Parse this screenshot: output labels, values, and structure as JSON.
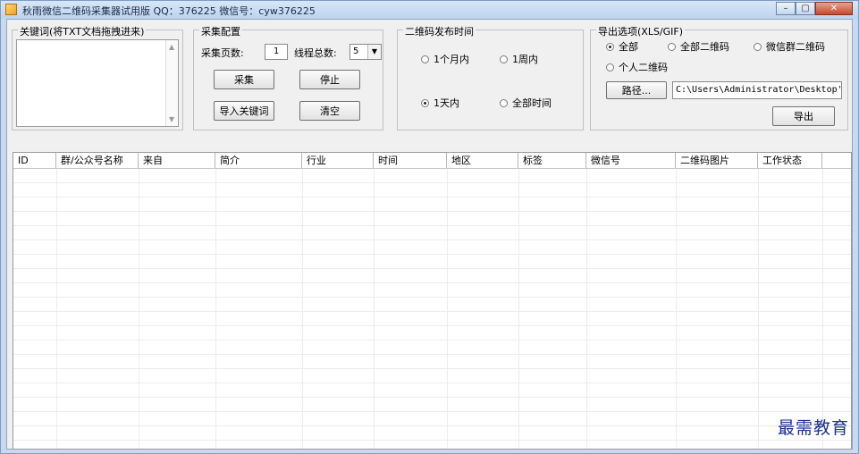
{
  "window": {
    "title": "秋雨微信二维码采集器试用版 QQ：376225   微信号：cyw376225",
    "min_glyph": "–",
    "max_glyph": "▢",
    "close_glyph": "✕"
  },
  "keywords": {
    "legend": "关键词(将TXT文档拖拽进来)",
    "value": ""
  },
  "collect_config": {
    "legend": "采集配置",
    "pages_label": "采集页数:",
    "pages_value": "1",
    "threads_label": "线程总数:",
    "threads_value": "5",
    "collect_button": "采集",
    "stop_button": "停止",
    "import_button": "导入关键词",
    "clear_button": "清空"
  },
  "publish_time": {
    "legend": "二维码发布时间",
    "options": [
      "1个月内",
      "1周内",
      "1天内",
      "全部时间"
    ],
    "selected": "1天内"
  },
  "export": {
    "legend": "导出选项(XLS/GIF)",
    "options": [
      "全部",
      "全部二维码",
      "微信群二维码",
      "个人二维码"
    ],
    "selected": "全部",
    "path_button": "路径...",
    "path_value": "C:\\Users\\Administrator\\Desktop'",
    "export_button": "导出"
  },
  "table": {
    "columns": [
      "ID",
      "群/公众号名称",
      "来自",
      "简介",
      "行业",
      "时间",
      "地区",
      "标签",
      "微信号",
      "二维码图片",
      "工作状态"
    ],
    "rows": []
  },
  "watermark": "最需教育"
}
